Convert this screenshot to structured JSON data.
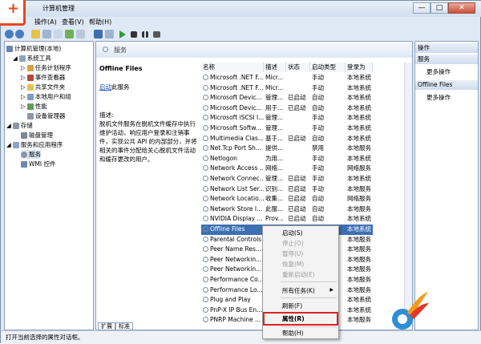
{
  "window": {
    "title": "计算机管理",
    "min_glyph": "—",
    "max_glyph": "□",
    "close_glyph": "✕"
  },
  "menu": [
    "操作(A)",
    "查看(V)",
    "帮助(H)"
  ],
  "tree": [
    {
      "label": "计算机管理(本地)",
      "level": 0
    },
    {
      "label": "系统工具",
      "level": 1
    },
    {
      "label": "任务计划程序",
      "level": 2
    },
    {
      "label": "事件查看器",
      "level": 2
    },
    {
      "label": "共享文件夹",
      "level": 2
    },
    {
      "label": "本地用户和组",
      "level": 2
    },
    {
      "label": "性能",
      "level": 2
    },
    {
      "label": "设备管理器",
      "level": 2
    },
    {
      "label": "存储",
      "level": 1
    },
    {
      "label": "磁盘管理",
      "level": 2
    },
    {
      "label": "服务和应用程序",
      "level": 1
    },
    {
      "label": "服务",
      "level": 2
    },
    {
      "label": "WMI 控件",
      "level": 2
    }
  ],
  "main": {
    "header": "服务",
    "desc_title": "Offline Files",
    "start_link": "启动",
    "start_suffix": "此服务",
    "desc_label": "描述:",
    "desc_text": "脱机文件服务在脱机文件缓存中执行维护活动，响应用户登录和注销事件，实现公共 API 的内部部分，并将相关的事件分配给关心脱机文件活动和缓存更改的用户。",
    "columns": [
      "名称",
      "描述",
      "状态",
      "启动类型",
      "登录为"
    ],
    "tabs": [
      "扩展",
      "标准"
    ]
  },
  "rows": [
    [
      "Microsoft .NET F...",
      "Micr...",
      "",
      "手动",
      "本地系统"
    ],
    [
      "Microsoft .NET F...",
      "Micr...",
      "",
      "手动",
      "本地系统"
    ],
    [
      "Microsoft Devic...",
      "管理...",
      "已启动",
      "自动",
      "本地系统"
    ],
    [
      "Microsoft Devic...",
      "用于...",
      "已启动",
      "自动",
      "本地系统"
    ],
    [
      "Microsoft iSCSI I...",
      "管理...",
      "",
      "手动",
      "本地系统"
    ],
    [
      "Microsoft Softw...",
      "管理...",
      "",
      "手动",
      "本地系统"
    ],
    [
      "Multimedia Clas...",
      "基于...",
      "已启动",
      "自动",
      "本地系统"
    ],
    [
      "Net.Tcp Port Sh...",
      "提供...",
      "",
      "禁用",
      "本地服务"
    ],
    [
      "Netlogon",
      "为用...",
      "",
      "手动",
      "本地系统"
    ],
    [
      "Network Access ...",
      "网络...",
      "",
      "手动",
      "网络服务"
    ],
    [
      "Network Connec...",
      "管理...",
      "已启动",
      "手动",
      "本地系统"
    ],
    [
      "Network List Ser...",
      "识别...",
      "已启动",
      "手动",
      "本地服务"
    ],
    [
      "Network Locatio...",
      "收集...",
      "已启动",
      "自动",
      "网络服务"
    ],
    [
      "Network Store I...",
      "此服...",
      "已启动",
      "自动",
      "本地服务"
    ],
    [
      "NVIDIA Display ...",
      "Prov...",
      "已启动",
      "自动",
      "本地系统"
    ],
    [
      "Offline Files",
      "",
      "",
      "",
      "本地系统"
    ],
    [
      "Parental Controls",
      "",
      "",
      "",
      "本地服务"
    ],
    [
      "Peer Name Res...",
      "",
      "",
      "",
      "本地服务"
    ],
    [
      "Peer Networkin...",
      "",
      "",
      "",
      "本地服务"
    ],
    [
      "Peer Networkin...",
      "",
      "",
      "",
      "本地服务"
    ],
    [
      "Performance Co...",
      "",
      "",
      "",
      "本地服务"
    ],
    [
      "Performance Lo...",
      "",
      "",
      "",
      "本地服务"
    ],
    [
      "Plug and Play",
      "",
      "",
      "",
      "本地系统"
    ],
    [
      "PnP-X IP Bus En...",
      "",
      "",
      "",
      "本地系统"
    ],
    [
      "PNRP Machine ...",
      "",
      "",
      "",
      "本地服务"
    ]
  ],
  "selected_row": 15,
  "actions": {
    "header": "操作",
    "group1": "服务",
    "more1": "更多操作",
    "group2": "Offline Files",
    "more2": "更多操作"
  },
  "context_menu": [
    {
      "label": "启动(S)",
      "disabled": false
    },
    {
      "label": "停止(O)",
      "disabled": true
    },
    {
      "label": "暂停(U)",
      "disabled": true
    },
    {
      "label": "恢复(M)",
      "disabled": true
    },
    {
      "label": "重新启动(E)",
      "disabled": true
    },
    {
      "label": "所有任务(K)",
      "disabled": false,
      "submenu": true
    },
    {
      "label": "刷新(F)",
      "disabled": false
    },
    {
      "label": "属性(R)",
      "disabled": false,
      "bold": true
    },
    {
      "label": "帮助(H)",
      "disabled": false
    }
  ],
  "status_text": "打开当前选择的属性对话框。",
  "colors": {
    "selection": "#3d6fb3",
    "highlight_box": "#d22222"
  }
}
